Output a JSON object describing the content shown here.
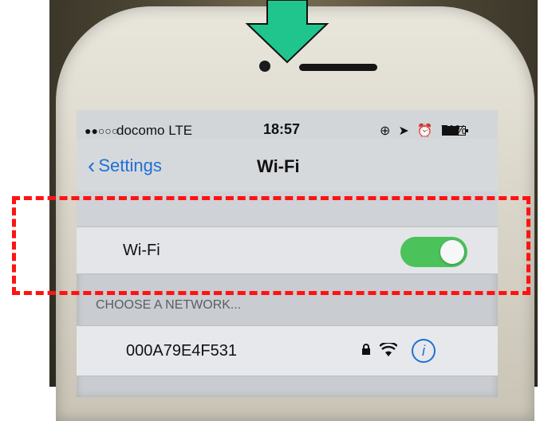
{
  "status_bar": {
    "signal_dots": "●●○○○",
    "carrier": "docomo  LTE",
    "time": "18:57",
    "icons_right": [
      "rotation-lock-icon",
      "location-icon",
      "alarm-icon"
    ],
    "battery_percent": "71%"
  },
  "nav": {
    "back_label": "Settings",
    "title": "Wi-Fi"
  },
  "wifi_toggle": {
    "label": "Wi-Fi",
    "state": "on",
    "color_on": "#4cc25a"
  },
  "networks": {
    "header": "CHOOSE A NETWORK...",
    "items": [
      {
        "ssid": "000A79E4F531",
        "secured": true,
        "icon": "wifi-icon",
        "info": "i"
      }
    ]
  },
  "annotation": {
    "arrow_color": "#20c58e",
    "highlight_color": "#ff1212"
  }
}
